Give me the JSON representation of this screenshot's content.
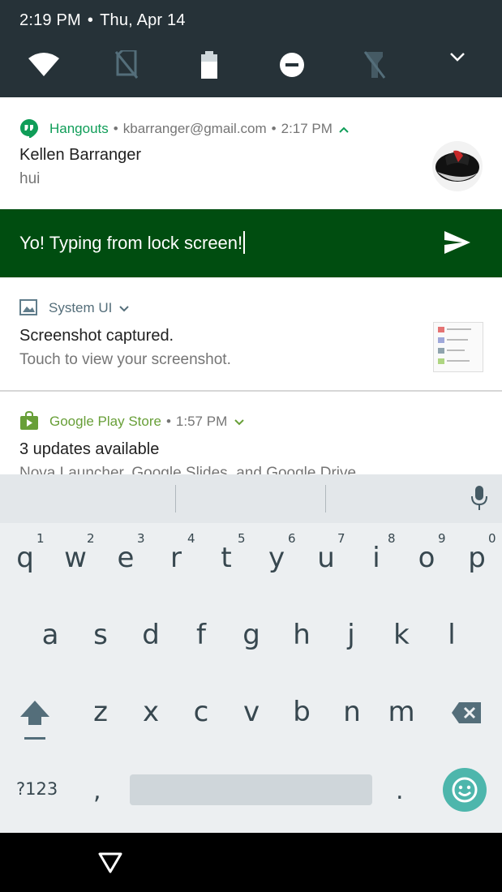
{
  "status_bar": {
    "time": "2:19 PM",
    "separator": "•",
    "date": "Thu, Apr 14"
  },
  "quick_settings": [
    "wifi-icon",
    "no-sim-icon",
    "battery-icon",
    "do-not-disturb-icon",
    "flashlight-off-icon",
    "expand-chevron-icon"
  ],
  "hangouts": {
    "app": "Hangouts",
    "account": "kbarranger@gmail.com",
    "time": "2:17 PM",
    "sep": "•",
    "title": "Kellen Barranger",
    "text": "hui",
    "reply_text": "Yo! Typing from lock screen!",
    "accent": "#0f9d58",
    "reply_bg": "#004d10"
  },
  "systemui": {
    "app": "System UI",
    "title": "Screenshot captured.",
    "text": "Touch to view your screenshot."
  },
  "playstore": {
    "app": "Google Play Store",
    "time": "1:57 PM",
    "sep": "•",
    "title": "3 updates available",
    "text": "Nova Launcher, Google Slides, and Google Drive",
    "accent": "#689f38"
  },
  "keyboard": {
    "row1": [
      "q",
      "w",
      "e",
      "r",
      "t",
      "y",
      "u",
      "i",
      "o",
      "p"
    ],
    "row1_hints": [
      "1",
      "2",
      "3",
      "4",
      "5",
      "6",
      "7",
      "8",
      "9",
      "0"
    ],
    "row2": [
      "a",
      "s",
      "d",
      "f",
      "g",
      "h",
      "j",
      "k",
      "l"
    ],
    "row3": [
      "z",
      "x",
      "c",
      "v",
      "b",
      "n",
      "m"
    ],
    "symbols_label": "?123",
    "comma": ",",
    "period": "."
  }
}
